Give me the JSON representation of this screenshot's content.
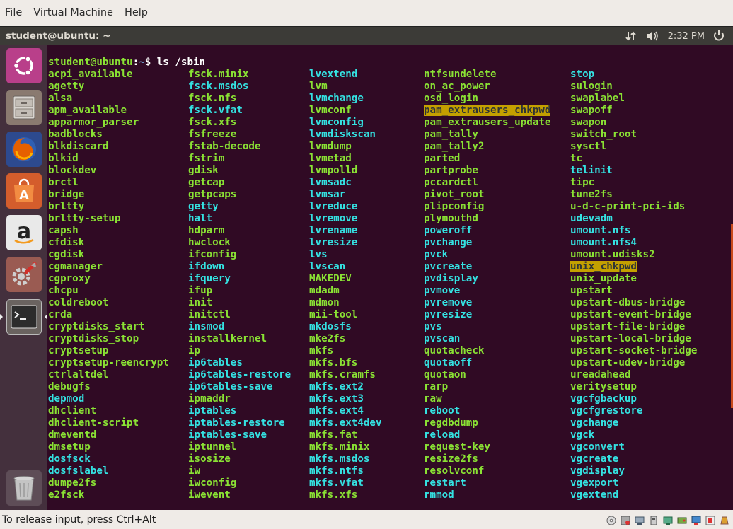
{
  "host_menu": [
    "File",
    "Virtual Machine",
    "Help"
  ],
  "panel": {
    "title": "student@ubuntu: ~",
    "time": "2:32 PM"
  },
  "launcher": [
    "ubuntu-dash-icon",
    "files-icon",
    "firefox-icon",
    "software-center-icon",
    "amazon-icon",
    "system-settings-icon",
    "terminal-icon",
    "trash-icon"
  ],
  "terminal": {
    "prompt_user": "student@ubuntu",
    "prompt_colon": ":",
    "prompt_path": "~",
    "prompt_cmd": "$ ls /sbin",
    "columns": [
      [
        {
          "n": "acpi_available",
          "t": "exec"
        },
        {
          "n": "agetty",
          "t": "exec"
        },
        {
          "n": "alsa",
          "t": "exec"
        },
        {
          "n": "apm_available",
          "t": "exec"
        },
        {
          "n": "apparmor_parser",
          "t": "exec"
        },
        {
          "n": "badblocks",
          "t": "exec"
        },
        {
          "n": "blkdiscard",
          "t": "exec"
        },
        {
          "n": "blkid",
          "t": "exec"
        },
        {
          "n": "blockdev",
          "t": "exec"
        },
        {
          "n": "brctl",
          "t": "exec"
        },
        {
          "n": "bridge",
          "t": "exec"
        },
        {
          "n": "brltty",
          "t": "exec"
        },
        {
          "n": "brltty-setup",
          "t": "exec"
        },
        {
          "n": "capsh",
          "t": "exec"
        },
        {
          "n": "cfdisk",
          "t": "exec"
        },
        {
          "n": "cgdisk",
          "t": "exec"
        },
        {
          "n": "cgmanager",
          "t": "exec"
        },
        {
          "n": "cgproxy",
          "t": "exec"
        },
        {
          "n": "chcpu",
          "t": "exec"
        },
        {
          "n": "coldreboot",
          "t": "exec"
        },
        {
          "n": "crda",
          "t": "exec"
        },
        {
          "n": "cryptdisks_start",
          "t": "exec"
        },
        {
          "n": "cryptdisks_stop",
          "t": "exec"
        },
        {
          "n": "cryptsetup",
          "t": "exec"
        },
        {
          "n": "cryptsetup-reencrypt",
          "t": "exec"
        },
        {
          "n": "ctrlaltdel",
          "t": "exec"
        },
        {
          "n": "debugfs",
          "t": "exec"
        },
        {
          "n": "depmod",
          "t": "link"
        },
        {
          "n": "dhclient",
          "t": "exec"
        },
        {
          "n": "dhclient-script",
          "t": "exec"
        },
        {
          "n": "dmeventd",
          "t": "exec"
        },
        {
          "n": "dmsetup",
          "t": "exec"
        },
        {
          "n": "dosfsck",
          "t": "link"
        },
        {
          "n": "dosfslabel",
          "t": "link"
        },
        {
          "n": "dumpe2fs",
          "t": "exec"
        },
        {
          "n": "e2fsck",
          "t": "exec"
        }
      ],
      [
        {
          "n": "fsck.minix",
          "t": "exec"
        },
        {
          "n": "fsck.msdos",
          "t": "link"
        },
        {
          "n": "fsck.nfs",
          "t": "exec"
        },
        {
          "n": "fsck.vfat",
          "t": "link"
        },
        {
          "n": "fsck.xfs",
          "t": "exec"
        },
        {
          "n": "fsfreeze",
          "t": "exec"
        },
        {
          "n": "fstab-decode",
          "t": "exec"
        },
        {
          "n": "fstrim",
          "t": "exec"
        },
        {
          "n": "gdisk",
          "t": "exec"
        },
        {
          "n": "getcap",
          "t": "exec"
        },
        {
          "n": "getpcaps",
          "t": "exec"
        },
        {
          "n": "getty",
          "t": "link"
        },
        {
          "n": "halt",
          "t": "link"
        },
        {
          "n": "hdparm",
          "t": "exec"
        },
        {
          "n": "hwclock",
          "t": "exec"
        },
        {
          "n": "ifconfig",
          "t": "exec"
        },
        {
          "n": "ifdown",
          "t": "link"
        },
        {
          "n": "ifquery",
          "t": "link"
        },
        {
          "n": "ifup",
          "t": "exec"
        },
        {
          "n": "init",
          "t": "exec"
        },
        {
          "n": "initctl",
          "t": "exec"
        },
        {
          "n": "insmod",
          "t": "link"
        },
        {
          "n": "installkernel",
          "t": "exec"
        },
        {
          "n": "ip",
          "t": "exec"
        },
        {
          "n": "ip6tables",
          "t": "link"
        },
        {
          "n": "ip6tables-restore",
          "t": "link"
        },
        {
          "n": "ip6tables-save",
          "t": "link"
        },
        {
          "n": "ipmaddr",
          "t": "exec"
        },
        {
          "n": "iptables",
          "t": "link"
        },
        {
          "n": "iptables-restore",
          "t": "link"
        },
        {
          "n": "iptables-save",
          "t": "link"
        },
        {
          "n": "iptunnel",
          "t": "exec"
        },
        {
          "n": "isosize",
          "t": "exec"
        },
        {
          "n": "iw",
          "t": "exec"
        },
        {
          "n": "iwconfig",
          "t": "exec"
        },
        {
          "n": "iwevent",
          "t": "exec"
        }
      ],
      [
        {
          "n": "lvextend",
          "t": "link"
        },
        {
          "n": "lvm",
          "t": "exec"
        },
        {
          "n": "lvmchange",
          "t": "link"
        },
        {
          "n": "lvmconf",
          "t": "exec"
        },
        {
          "n": "lvmconfig",
          "t": "link"
        },
        {
          "n": "lvmdiskscan",
          "t": "link"
        },
        {
          "n": "lvmdump",
          "t": "exec"
        },
        {
          "n": "lvmetad",
          "t": "exec"
        },
        {
          "n": "lvmpolld",
          "t": "exec"
        },
        {
          "n": "lvmsadc",
          "t": "link"
        },
        {
          "n": "lvmsar",
          "t": "link"
        },
        {
          "n": "lvreduce",
          "t": "link"
        },
        {
          "n": "lvremove",
          "t": "link"
        },
        {
          "n": "lvrename",
          "t": "link"
        },
        {
          "n": "lvresize",
          "t": "link"
        },
        {
          "n": "lvs",
          "t": "link"
        },
        {
          "n": "lvscan",
          "t": "link"
        },
        {
          "n": "MAKEDEV",
          "t": "exec"
        },
        {
          "n": "mdadm",
          "t": "exec"
        },
        {
          "n": "mdmon",
          "t": "exec"
        },
        {
          "n": "mii-tool",
          "t": "exec"
        },
        {
          "n": "mkdosfs",
          "t": "link"
        },
        {
          "n": "mke2fs",
          "t": "exec"
        },
        {
          "n": "mkfs",
          "t": "exec"
        },
        {
          "n": "mkfs.bfs",
          "t": "exec"
        },
        {
          "n": "mkfs.cramfs",
          "t": "exec"
        },
        {
          "n": "mkfs.ext2",
          "t": "link"
        },
        {
          "n": "mkfs.ext3",
          "t": "link"
        },
        {
          "n": "mkfs.ext4",
          "t": "link"
        },
        {
          "n": "mkfs.ext4dev",
          "t": "link"
        },
        {
          "n": "mkfs.fat",
          "t": "exec"
        },
        {
          "n": "mkfs.minix",
          "t": "exec"
        },
        {
          "n": "mkfs.msdos",
          "t": "link"
        },
        {
          "n": "mkfs.ntfs",
          "t": "link"
        },
        {
          "n": "mkfs.vfat",
          "t": "link"
        },
        {
          "n": "mkfs.xfs",
          "t": "exec"
        }
      ],
      [
        {
          "n": "ntfsundelete",
          "t": "exec"
        },
        {
          "n": "on_ac_power",
          "t": "exec"
        },
        {
          "n": "osd_login",
          "t": "exec"
        },
        {
          "n": "pam_extrausers_chkpwd",
          "t": "setuid"
        },
        {
          "n": "pam_extrausers_update",
          "t": "exec"
        },
        {
          "n": "pam_tally",
          "t": "exec"
        },
        {
          "n": "pam_tally2",
          "t": "exec"
        },
        {
          "n": "parted",
          "t": "exec"
        },
        {
          "n": "partprobe",
          "t": "exec"
        },
        {
          "n": "pccardctl",
          "t": "exec"
        },
        {
          "n": "pivot_root",
          "t": "exec"
        },
        {
          "n": "plipconfig",
          "t": "exec"
        },
        {
          "n": "plymouthd",
          "t": "exec"
        },
        {
          "n": "poweroff",
          "t": "link"
        },
        {
          "n": "pvchange",
          "t": "link"
        },
        {
          "n": "pvck",
          "t": "link"
        },
        {
          "n": "pvcreate",
          "t": "link"
        },
        {
          "n": "pvdisplay",
          "t": "link"
        },
        {
          "n": "pvmove",
          "t": "link"
        },
        {
          "n": "pvremove",
          "t": "link"
        },
        {
          "n": "pvresize",
          "t": "link"
        },
        {
          "n": "pvs",
          "t": "link"
        },
        {
          "n": "pvscan",
          "t": "link"
        },
        {
          "n": "quotacheck",
          "t": "exec"
        },
        {
          "n": "quotaoff",
          "t": "link"
        },
        {
          "n": "quotaon",
          "t": "exec"
        },
        {
          "n": "rarp",
          "t": "exec"
        },
        {
          "n": "raw",
          "t": "exec"
        },
        {
          "n": "reboot",
          "t": "link"
        },
        {
          "n": "regdbdump",
          "t": "exec"
        },
        {
          "n": "reload",
          "t": "link"
        },
        {
          "n": "request-key",
          "t": "exec"
        },
        {
          "n": "resize2fs",
          "t": "exec"
        },
        {
          "n": "resolvconf",
          "t": "exec"
        },
        {
          "n": "restart",
          "t": "link"
        },
        {
          "n": "rmmod",
          "t": "link"
        }
      ],
      [
        {
          "n": "stop",
          "t": "link"
        },
        {
          "n": "sulogin",
          "t": "exec"
        },
        {
          "n": "swaplabel",
          "t": "exec"
        },
        {
          "n": "swapoff",
          "t": "exec"
        },
        {
          "n": "swapon",
          "t": "exec"
        },
        {
          "n": "switch_root",
          "t": "exec"
        },
        {
          "n": "sysctl",
          "t": "exec"
        },
        {
          "n": "tc",
          "t": "exec"
        },
        {
          "n": "telinit",
          "t": "link"
        },
        {
          "n": "tipc",
          "t": "exec"
        },
        {
          "n": "tune2fs",
          "t": "exec"
        },
        {
          "n": "u-d-c-print-pci-ids",
          "t": "exec"
        },
        {
          "n": "udevadm",
          "t": "link"
        },
        {
          "n": "umount.nfs",
          "t": "link"
        },
        {
          "n": "umount.nfs4",
          "t": "link"
        },
        {
          "n": "umount.udisks2",
          "t": "exec"
        },
        {
          "n": "unix_chkpwd",
          "t": "setuid"
        },
        {
          "n": "unix_update",
          "t": "exec"
        },
        {
          "n": "upstart",
          "t": "exec"
        },
        {
          "n": "upstart-dbus-bridge",
          "t": "exec"
        },
        {
          "n": "upstart-event-bridge",
          "t": "exec"
        },
        {
          "n": "upstart-file-bridge",
          "t": "exec"
        },
        {
          "n": "upstart-local-bridge",
          "t": "exec"
        },
        {
          "n": "upstart-socket-bridge",
          "t": "exec"
        },
        {
          "n": "upstart-udev-bridge",
          "t": "exec"
        },
        {
          "n": "ureadahead",
          "t": "exec"
        },
        {
          "n": "veritysetup",
          "t": "exec"
        },
        {
          "n": "vgcfgbackup",
          "t": "link"
        },
        {
          "n": "vgcfgrestore",
          "t": "link"
        },
        {
          "n": "vgchange",
          "t": "link"
        },
        {
          "n": "vgck",
          "t": "link"
        },
        {
          "n": "vgconvert",
          "t": "link"
        },
        {
          "n": "vgcreate",
          "t": "link"
        },
        {
          "n": "vgdisplay",
          "t": "link"
        },
        {
          "n": "vgexport",
          "t": "link"
        },
        {
          "n": "vgextend",
          "t": "link"
        }
      ]
    ]
  },
  "status_bar": {
    "text": "To release input, press Ctrl+Alt"
  },
  "status_icons": [
    "cdrom-icon",
    "floppy-icon",
    "network-icon",
    "usb-icon",
    "shared-folder-icon",
    "hdd-icon",
    "display-icon",
    "recording-icon",
    "keyboard-capture-icon"
  ],
  "colors": {
    "terminal_bg": "#300a24",
    "exec": "#8ae234",
    "link": "#34e2e2",
    "setuid_bg": "#c4a000",
    "panel": "#3c3b37",
    "launcher": "#44303d"
  }
}
